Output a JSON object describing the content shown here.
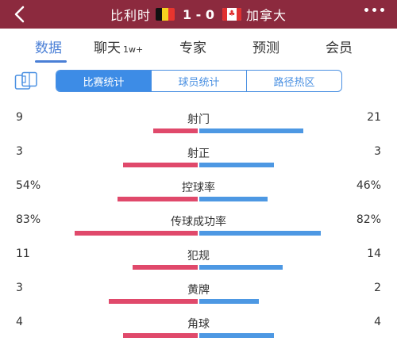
{
  "header": {
    "home_team": "比利时",
    "score": "1 - 0",
    "away_team": "加拿大",
    "home_flag": "belgium-flag",
    "away_flag": "canada-flag",
    "bg_color": "#8c2a3e"
  },
  "tabs": [
    {
      "label": "数据",
      "active": true
    },
    {
      "label": "聊天",
      "badge": "1w+"
    },
    {
      "label": "专家"
    },
    {
      "label": "预测"
    },
    {
      "label": "会员"
    }
  ],
  "segments": [
    "比赛统计",
    "球员统计",
    "路径热区"
  ],
  "colors": {
    "home": "#e0496b",
    "away": "#4d98e3",
    "accent": "#4a7fd6"
  },
  "stats": [
    {
      "label": "射门",
      "home": "9",
      "away": "21",
      "home_ratio": 0.3,
      "away_ratio": 0.7
    },
    {
      "label": "射正",
      "home": "3",
      "away": "3",
      "home_ratio": 0.5,
      "away_ratio": 0.5
    },
    {
      "label": "控球率",
      "home": "54%",
      "away": "46%",
      "home_ratio": 0.54,
      "away_ratio": 0.46
    },
    {
      "label": "传球成功率",
      "home": "83%",
      "away": "82%",
      "home_ratio": 0.83,
      "away_ratio": 0.82
    },
    {
      "label": "犯规",
      "home": "11",
      "away": "14",
      "home_ratio": 0.44,
      "away_ratio": 0.56
    },
    {
      "label": "黄牌",
      "home": "3",
      "away": "2",
      "home_ratio": 0.6,
      "away_ratio": 0.4
    },
    {
      "label": "角球",
      "home": "4",
      "away": "4",
      "home_ratio": 0.5,
      "away_ratio": 0.5
    }
  ]
}
